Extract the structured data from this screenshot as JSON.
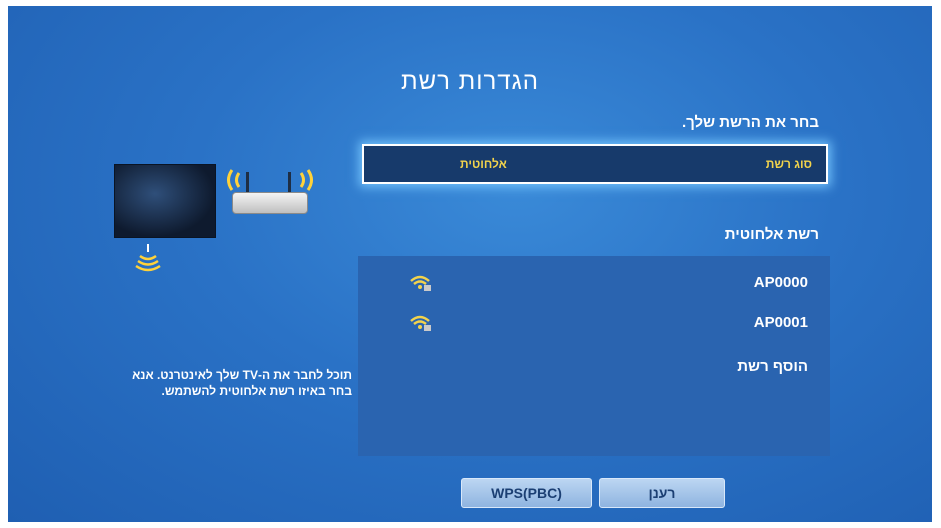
{
  "title": "הגדרות רשת",
  "prompt": "בחר את הרשת שלך.",
  "network_type": {
    "label": "סוג רשת",
    "value": "אלחוטית"
  },
  "wireless_title": "רשת אלחוטית",
  "networks": [
    {
      "name": "AP0000",
      "icon": "wifi-lock-icon"
    },
    {
      "name": "AP0001",
      "icon": "wifi-lock-icon"
    }
  ],
  "add_network": "הוסף רשת",
  "help_line1": "תוכל לחבר את ה-TV שלך לאינטרנט. אנא",
  "help_line2": "בחר באיזו רשת אלחוטית להשתמש.",
  "buttons": {
    "wps": "WPS(PBC)",
    "refresh": "רענן"
  },
  "colors": {
    "background": "#2a72c6",
    "highlight_text": "#f2d34c",
    "selected_box": "#173a6b"
  }
}
